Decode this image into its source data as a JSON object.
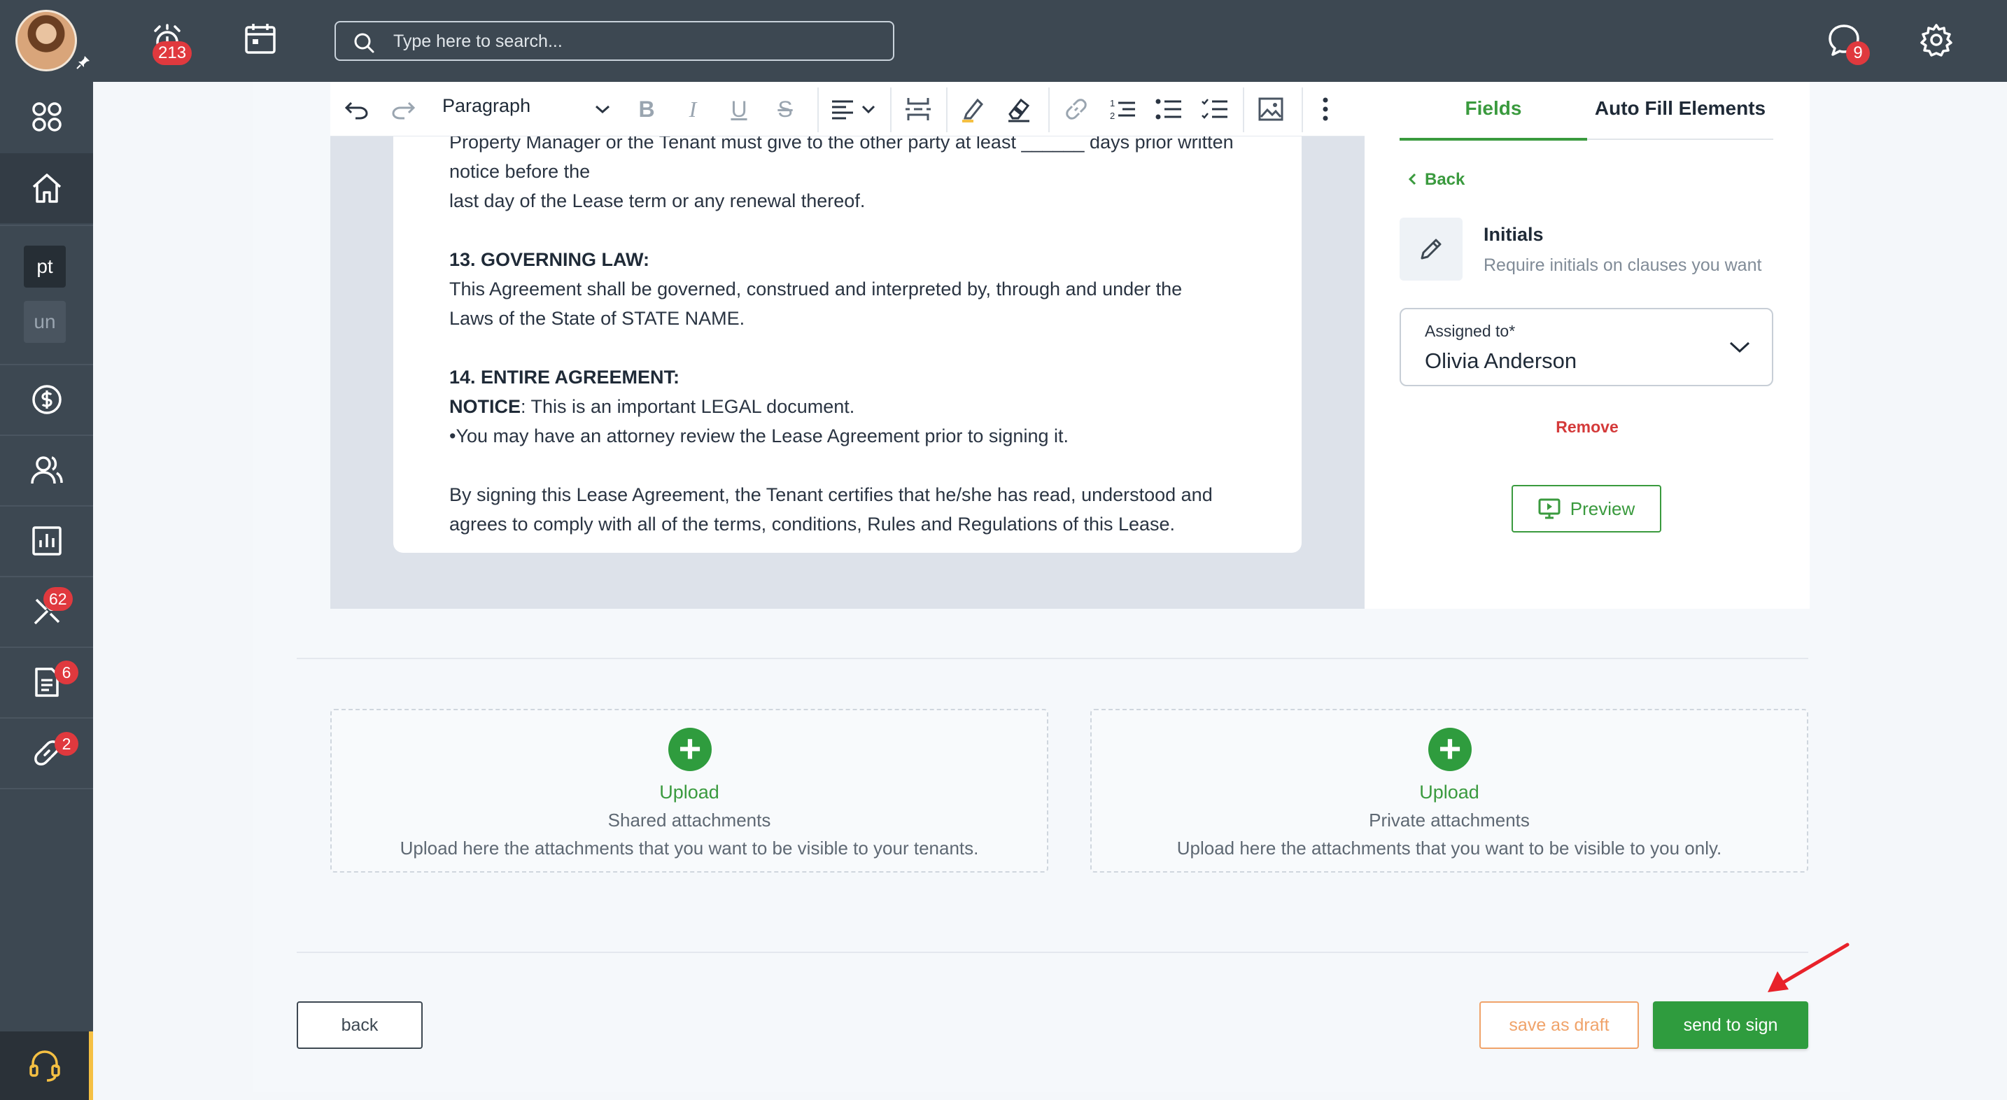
{
  "topbar": {
    "alerts_badge": "213",
    "messages_badge": "9",
    "search_placeholder": "Type here to search..."
  },
  "sidebar": {
    "items": [
      {
        "name": "apps",
        "icon": "apps-grid-icon"
      },
      {
        "name": "home",
        "icon": "home-icon",
        "active": true
      },
      {
        "name": "pt",
        "label": "pt"
      },
      {
        "name": "un",
        "label": "un"
      },
      {
        "name": "accounting",
        "icon": "dollar-icon"
      },
      {
        "name": "people",
        "icon": "users-icon"
      },
      {
        "name": "reports",
        "icon": "bar-chart-icon"
      },
      {
        "name": "maintenance",
        "icon": "tools-icon",
        "badge": "62"
      },
      {
        "name": "documents",
        "icon": "document-icon",
        "badge": "6"
      },
      {
        "name": "links",
        "icon": "link-icon",
        "badge": "2"
      }
    ],
    "support_icon": "headset-icon"
  },
  "editor": {
    "toolbar": {
      "block_format": "Paragraph"
    },
    "document": {
      "line1": "Property Manager or the Tenant must give to the other party at least ______ days prior written",
      "line2": "notice before the",
      "line3": "last day of the Lease term or any renewal thereof.",
      "heading13": "13. GOVERNING LAW:",
      "p13a": "This Agreement shall be governed, construed and interpreted by, through and under the",
      "p13b": "Laws of the State of STATE NAME.",
      "heading14": "14. ENTIRE AGREEMENT:",
      "notice_label": "NOTICE",
      "notice_text": ": This is an important LEGAL document.",
      "bullet": "•You may have an attorney review the Lease Agreement prior to signing it.",
      "final1": "By signing this Lease Agreement, the Tenant certifies that he/she has read, understood and",
      "final2": "agrees to comply with all of the terms, conditions, Rules and Regulations of this Lease."
    }
  },
  "panel": {
    "tabs": [
      {
        "label": "Fields",
        "active": true
      },
      {
        "label": "Auto Fill Elements",
        "active": false
      }
    ],
    "back_label": "Back",
    "field_title": "Initials",
    "field_subtitle": "Require initials on clauses you want",
    "assigned_label": "Assigned to*",
    "assigned_value": "Olivia Anderson",
    "remove_label": "Remove",
    "preview_label": "Preview"
  },
  "attachments": {
    "shared": {
      "action": "Upload",
      "title": "Shared attachments",
      "description": "Upload here the attachments that you want to be visible to your tenants."
    },
    "private": {
      "action": "Upload",
      "title": "Private attachments",
      "description": "Upload here the attachments that you want to be visible to you only."
    }
  },
  "footer": {
    "back_label": "back",
    "draft_label": "save as draft",
    "send_label": "send to sign"
  },
  "colors": {
    "topbar": "#3d4852",
    "accent_green": "#3a9a3e",
    "badge_red": "#e0393e",
    "draft_orange": "#f0a36a",
    "remove_red": "#d43a3a"
  }
}
